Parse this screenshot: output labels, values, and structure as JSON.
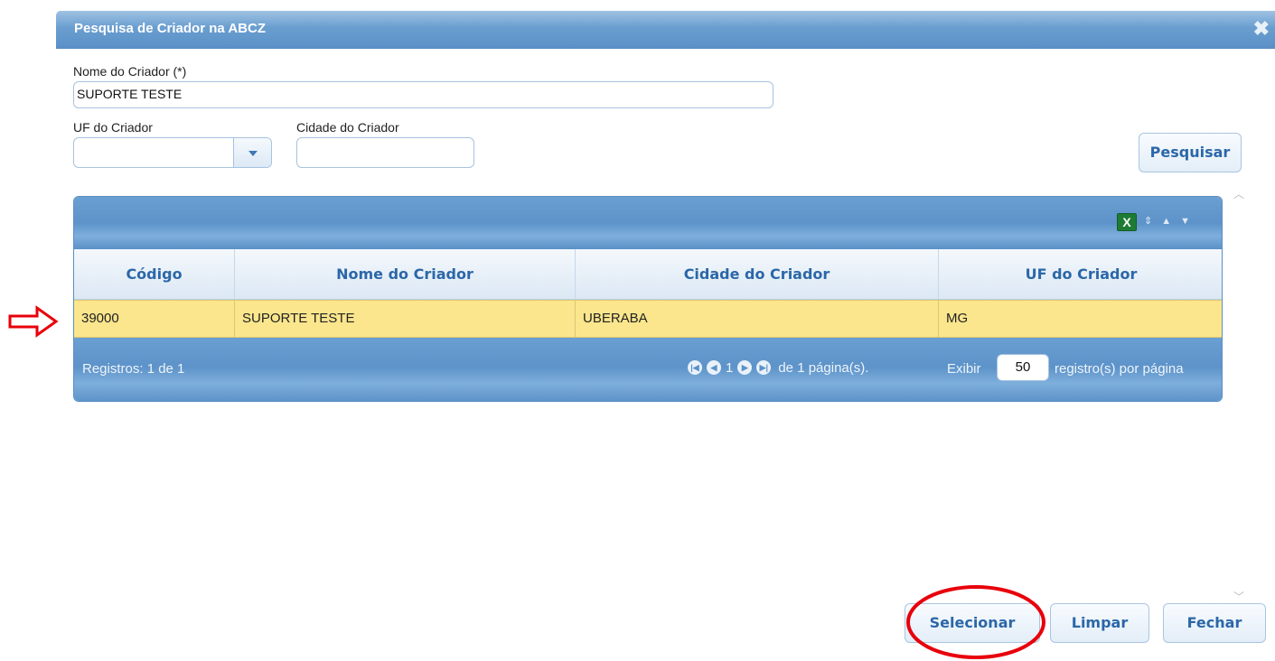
{
  "dialog": {
    "title": "Pesquisa de Criador na ABCZ",
    "close_glyph": "✖",
    "accent_color": "#5b91c7",
    "highlight_color": "#fbe68d"
  },
  "form": {
    "nome_label": "Nome do Criador (*)",
    "nome_value": "SUPORTE TESTE",
    "uf_label": "UF do Criador",
    "uf_value": "",
    "cidade_label": "Cidade do Criador",
    "cidade_value": "",
    "search_button": "Pesquisar"
  },
  "grid": {
    "toolbar_icons": [
      "excel-export-icon",
      "sort-icon",
      "move-up-icon",
      "move-down-icon"
    ],
    "excel_glyph": "X",
    "columns": [
      "Código",
      "Nome do Criador",
      "Cidade do Criador",
      "UF do Criador"
    ],
    "rows": [
      [
        "39000",
        "SUPORTE TESTE",
        "UBERABA",
        "MG"
      ]
    ],
    "selected_row": 0,
    "pager": {
      "records": "Registros: 1 de 1",
      "current_page": "1",
      "of_pages": "de 1 página(s).",
      "show_label": "Exibir",
      "page_size": "50",
      "per_page_label": "registro(s) por página"
    }
  },
  "footer": {
    "select_button": "Selecionar",
    "clear_button": "Limpar",
    "close_button": "Fechar"
  },
  "annotations": {
    "arrow_color": "#e8000b",
    "circle_color": "#e8000b"
  }
}
